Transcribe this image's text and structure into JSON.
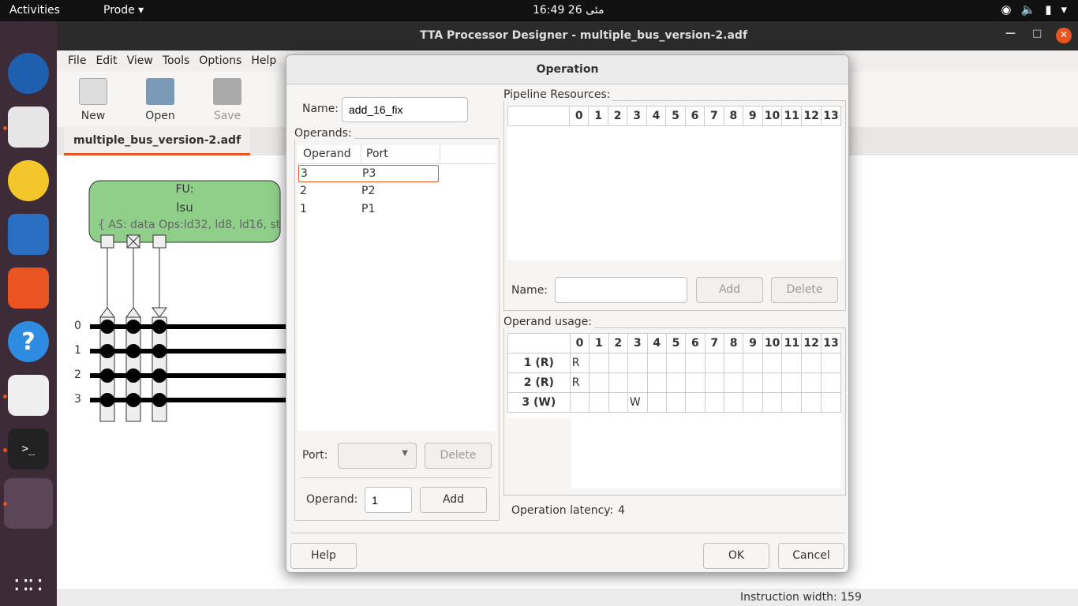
{
  "topbar": {
    "activities": "Activities",
    "app_menu": "Prode ▾",
    "clock": "16:49  26 مئى"
  },
  "dock": {
    "items": [
      "thunderbird-icon",
      "files-icon",
      "rhythmbox-icon",
      "impress-icon",
      "app-center-icon",
      "help-icon",
      "document-viewer-icon",
      "terminal-icon",
      "active-app-icon",
      "show-apps-icon"
    ]
  },
  "window": {
    "title": "TTA Processor Designer - multiple_bus_version-2.adf",
    "menu": [
      "File",
      "Edit",
      "View",
      "Tools",
      "Options",
      "Help"
    ],
    "toolbar": {
      "new": "New",
      "open": "Open",
      "save": "Save"
    },
    "doc_tab": "multiple_bus_version-2.adf",
    "status": "Instruction width: 159",
    "canvas": {
      "fu_title": "FU:",
      "fu_name": "lsu",
      "fu_desc": "{ AS: data Ops:ld32, ld8, ld16, st...",
      "bus_labels": [
        "0",
        "1",
        "2",
        "3"
      ]
    }
  },
  "dialog": {
    "title": "Operation",
    "name_label": "Name:",
    "name_value": "add_16_fix",
    "operands_group": "Operands:",
    "operands_headers": [
      "Operand",
      "Port"
    ],
    "operands_rows": [
      {
        "operand": "3",
        "port": "P3"
      },
      {
        "operand": "2",
        "port": "P2"
      },
      {
        "operand": "1",
        "port": "P1"
      }
    ],
    "port_label": "Port:",
    "port_value": "",
    "delete_operand": "Delete",
    "operand_label": "Operand:",
    "operand_value": "1",
    "add_operand": "Add",
    "pipeline_group": "Pipeline Resources:",
    "columns": [
      "0",
      "1",
      "2",
      "3",
      "4",
      "5",
      "6",
      "7",
      "8",
      "9",
      "10",
      "11",
      "12",
      "13"
    ],
    "resource_name_label": "Name:",
    "resource_name_value": "",
    "add_resource": "Add",
    "delete_resource": "Delete",
    "usage_group": "Operand usage:",
    "usage_rows": [
      {
        "label": "1 (R)",
        "cells": [
          "R",
          "",
          "",
          "",
          "",
          "",
          "",
          "",
          "",
          "",
          "",
          "",
          "",
          ""
        ]
      },
      {
        "label": "2 (R)",
        "cells": [
          "R",
          "",
          "",
          "",
          "",
          "",
          "",
          "",
          "",
          "",
          "",
          "",
          "",
          ""
        ]
      },
      {
        "label": "3 (W)",
        "cells": [
          "",
          "",
          "",
          "W",
          "",
          "",
          "",
          "",
          "",
          "",
          "",
          "",
          "",
          ""
        ]
      }
    ],
    "latency_label": "Operation latency:",
    "latency_value": "4",
    "help": "Help",
    "ok": "OK",
    "cancel": "Cancel"
  }
}
